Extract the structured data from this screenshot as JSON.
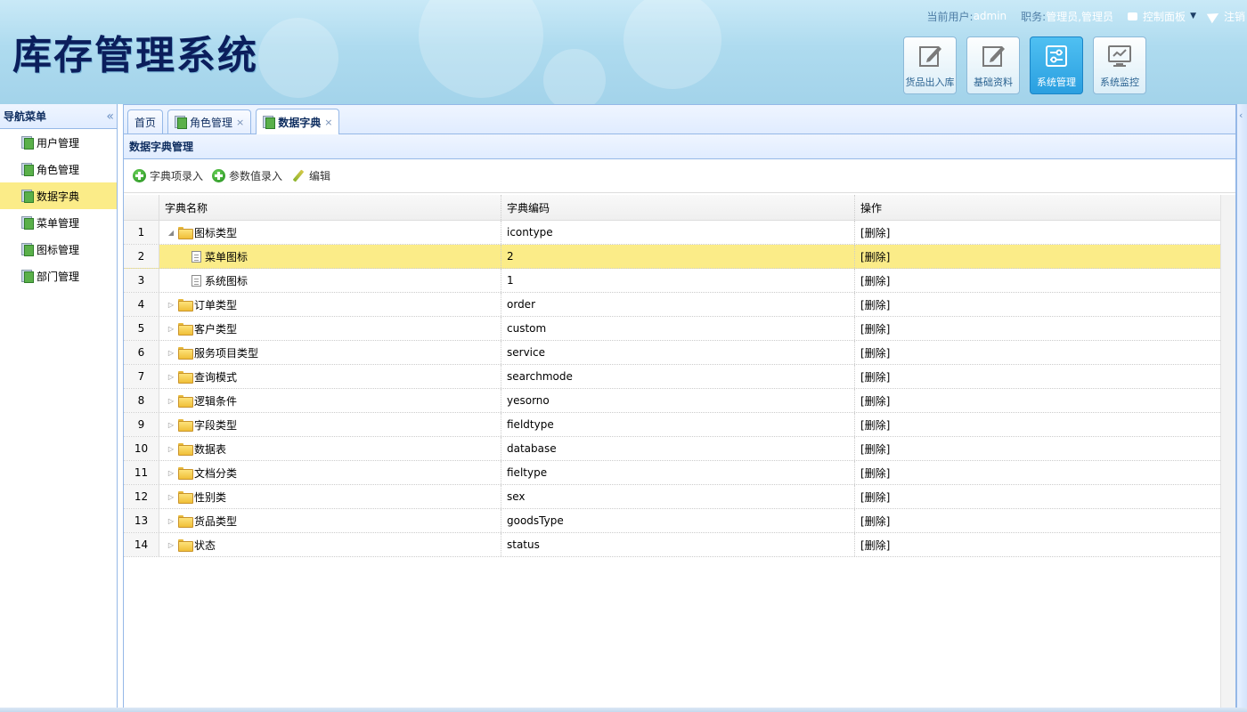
{
  "header": {
    "app_title": "库存管理系统",
    "user_label": "当前用户:",
    "user_name": "admin",
    "role_label": "职务:",
    "role_value": "管理员,管理员",
    "control_panel": "控制面板",
    "logout": "注销",
    "modules": [
      {
        "label": "货品出入库",
        "icon": "edit-icon",
        "active": false
      },
      {
        "label": "基础资料",
        "icon": "edit-icon",
        "active": false
      },
      {
        "label": "系统管理",
        "icon": "settings-icon",
        "active": true
      },
      {
        "label": "系统监控",
        "icon": "monitor-icon",
        "active": false
      }
    ]
  },
  "nav": {
    "title": "导航菜单",
    "collapse_icon": "double-chevron-left-icon",
    "items": [
      {
        "label": "用户管理"
      },
      {
        "label": "角色管理"
      },
      {
        "label": "数据字典"
      },
      {
        "label": "菜单管理"
      },
      {
        "label": "图标管理"
      },
      {
        "label": "部门管理"
      }
    ],
    "active_index": 2
  },
  "tabs": [
    {
      "label": "首页",
      "closable": false,
      "icon": false
    },
    {
      "label": "角色管理",
      "closable": true,
      "icon": true
    },
    {
      "label": "数据字典",
      "closable": true,
      "icon": true,
      "active": true
    }
  ],
  "panel": {
    "title": "数据字典管理",
    "toolbar": {
      "add_item": "字典项录入",
      "add_value": "参数值录入",
      "edit": "编辑"
    }
  },
  "grid": {
    "columns": {
      "name": "字典名称",
      "code": "字典编码",
      "op": "操作"
    },
    "rows": [
      {
        "num": "1",
        "name": "图标类型",
        "code": "icontype",
        "op": "[删除]",
        "level": 0,
        "type": "folder",
        "state": "expanded"
      },
      {
        "num": "2",
        "name": "菜单图标",
        "code": "2",
        "op": "[删除]",
        "level": 1,
        "type": "file",
        "state": "leaf",
        "selected": true
      },
      {
        "num": "3",
        "name": "系统图标",
        "code": "1",
        "op": "[删除]",
        "level": 1,
        "type": "file",
        "state": "leaf"
      },
      {
        "num": "4",
        "name": "订单类型",
        "code": "order",
        "op": "[删除]",
        "level": 0,
        "type": "folder",
        "state": "collapsed"
      },
      {
        "num": "5",
        "name": "客户类型",
        "code": "custom",
        "op": "[删除]",
        "level": 0,
        "type": "folder",
        "state": "collapsed"
      },
      {
        "num": "6",
        "name": "服务项目类型",
        "code": "service",
        "op": "[删除]",
        "level": 0,
        "type": "folder",
        "state": "collapsed"
      },
      {
        "num": "7",
        "name": "查询模式",
        "code": "searchmode",
        "op": "[删除]",
        "level": 0,
        "type": "folder",
        "state": "collapsed"
      },
      {
        "num": "8",
        "name": "逻辑条件",
        "code": "yesorno",
        "op": "[删除]",
        "level": 0,
        "type": "folder",
        "state": "collapsed"
      },
      {
        "num": "9",
        "name": "字段类型",
        "code": "fieldtype",
        "op": "[删除]",
        "level": 0,
        "type": "folder",
        "state": "collapsed"
      },
      {
        "num": "10",
        "name": "数据表",
        "code": "database",
        "op": "[删除]",
        "level": 0,
        "type": "folder",
        "state": "collapsed"
      },
      {
        "num": "11",
        "name": "文档分类",
        "code": "fieltype",
        "op": "[删除]",
        "level": 0,
        "type": "folder",
        "state": "collapsed"
      },
      {
        "num": "12",
        "name": "性别类",
        "code": "sex",
        "op": "[删除]",
        "level": 0,
        "type": "folder",
        "state": "collapsed"
      },
      {
        "num": "13",
        "name": "货品类型",
        "code": "goodsType",
        "op": "[删除]",
        "level": 0,
        "type": "folder",
        "state": "collapsed"
      },
      {
        "num": "14",
        "name": "状态",
        "code": "status",
        "op": "[删除]",
        "level": 0,
        "type": "folder",
        "state": "collapsed"
      }
    ]
  },
  "colors": {
    "selected_row": "#fbec88",
    "border": "#95b8e7",
    "active_module": "#2a9fe0"
  }
}
